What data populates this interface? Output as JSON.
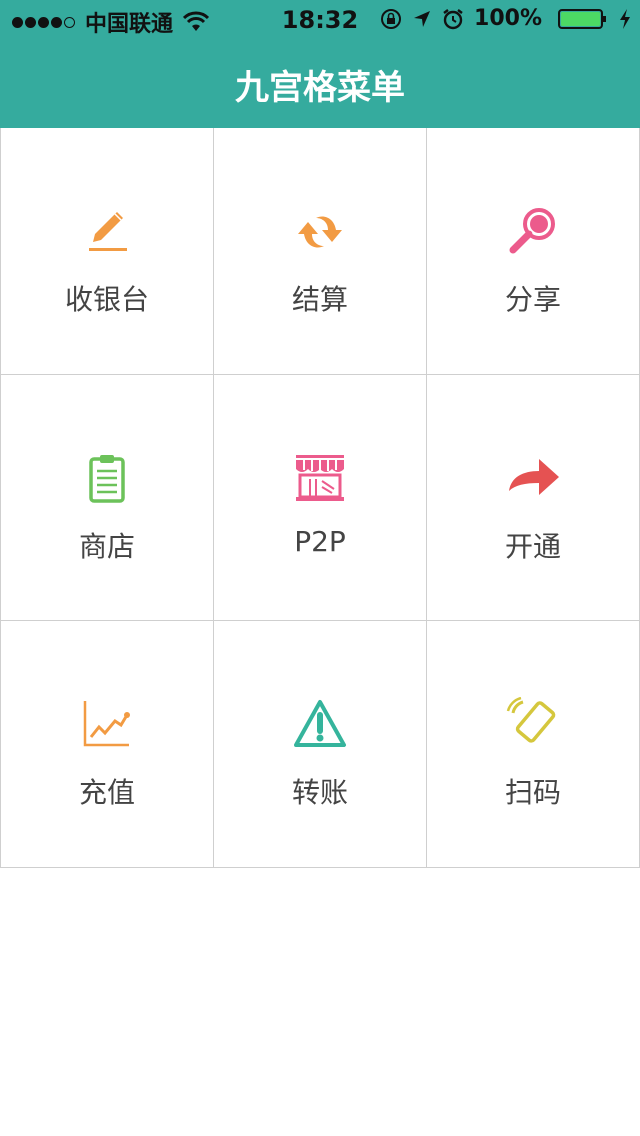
{
  "status_bar": {
    "carrier": "中国联通",
    "time": "18:32",
    "battery": "100%"
  },
  "nav": {
    "title": "九宫格菜单"
  },
  "menu": [
    {
      "label": "收银台",
      "icon": "pencil-icon",
      "color": "#f29b43"
    },
    {
      "label": "结算",
      "icon": "refresh-arrows-icon",
      "color": "#f29b43"
    },
    {
      "label": "分享",
      "icon": "search-icon",
      "color": "#ec5b8c"
    },
    {
      "label": "商店",
      "icon": "clipboard-icon",
      "color": "#6cc25a"
    },
    {
      "label": "P2P",
      "icon": "storefront-icon",
      "color": "#ec5b8c"
    },
    {
      "label": "开通",
      "icon": "share-arrow-icon",
      "color": "#e55252"
    },
    {
      "label": "充值",
      "icon": "line-chart-icon",
      "color": "#f29b43"
    },
    {
      "label": "转账",
      "icon": "warning-icon",
      "color": "#35b49c"
    },
    {
      "label": "扫码",
      "icon": "phone-vibrate-icon",
      "color": "#d5c73d"
    }
  ],
  "colors": {
    "header": "#35ab9e",
    "grid_line": "#cfcfcf",
    "label": "#444444"
  }
}
